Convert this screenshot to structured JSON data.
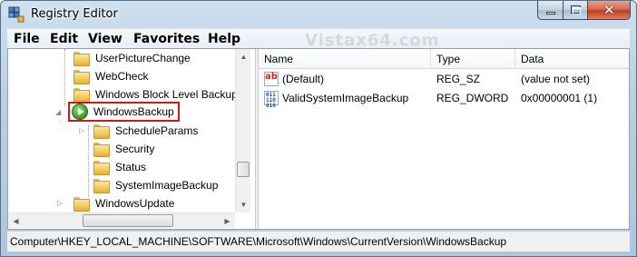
{
  "window": {
    "title": "Registry Editor",
    "accent_color": "#d0161b"
  },
  "menu": {
    "items": [
      {
        "label": "File"
      },
      {
        "label": "Edit"
      },
      {
        "label": "View"
      },
      {
        "label": "Favorites"
      },
      {
        "label": "Help"
      }
    ]
  },
  "watermark": "Vistax64.com",
  "tree": {
    "nodes": [
      {
        "label": "UserPictureChange",
        "icon": "folder-icon",
        "expanded": false
      },
      {
        "label": "WebCheck",
        "icon": "folder-icon",
        "expanded": false
      },
      {
        "label": "Windows Block Level Backup",
        "icon": "folder-icon",
        "expanded": false
      },
      {
        "label": "WindowsBackup",
        "icon": "play-icon",
        "expanded": true,
        "selected": true,
        "highlighted": true
      },
      {
        "label": "ScheduleParams",
        "icon": "folder-icon",
        "expanded": false
      },
      {
        "label": "Security",
        "icon": "folder-icon",
        "expanded": false
      },
      {
        "label": "Status",
        "icon": "folder-icon",
        "expanded": false
      },
      {
        "label": "SystemImageBackup",
        "icon": "folder-icon",
        "expanded": false
      },
      {
        "label": "WindowsUpdate",
        "icon": "folder-icon",
        "expanded": false
      }
    ]
  },
  "list": {
    "columns": [
      "Name",
      "Type",
      "Data"
    ],
    "rows": [
      {
        "name": "(Default)",
        "type": "REG_SZ",
        "data": "(value not set)",
        "icon": "string-value-icon"
      },
      {
        "name": "ValidSystemImageBackup",
        "type": "REG_DWORD",
        "data": "0x00000001 (1)",
        "icon": "binary-value-icon"
      }
    ]
  },
  "status": {
    "path": "Computer\\HKEY_LOCAL_MACHINE\\SOFTWARE\\Microsoft\\Windows\\CurrentVersion\\WindowsBackup"
  }
}
